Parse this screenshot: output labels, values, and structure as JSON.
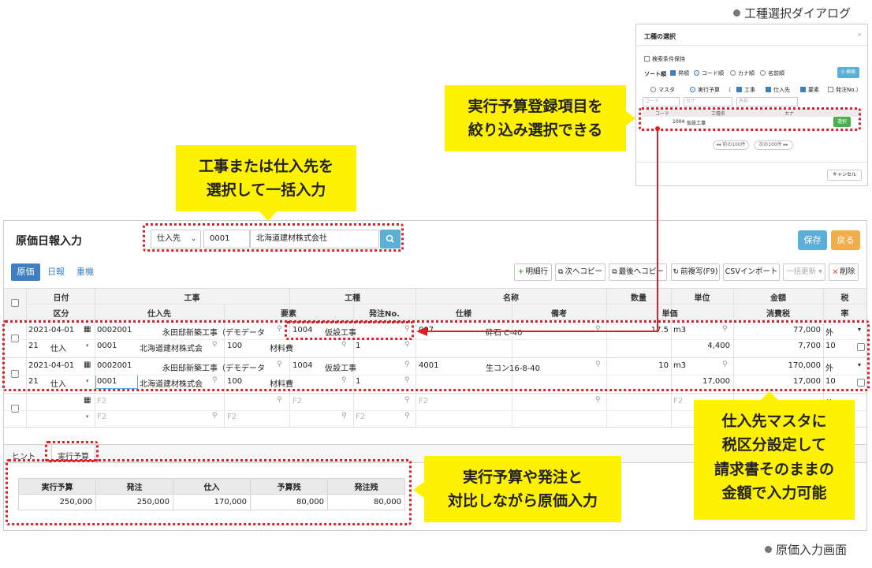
{
  "captions": {
    "dialog": "工種選択ダイアログ",
    "screen": "原価入力画面"
  },
  "colors": {
    "accent": "#3d7fc1",
    "save": "#5ab0d6",
    "back": "#f0ad4e",
    "callout": "#fff200",
    "highlight": "#d92027"
  },
  "callouts": {
    "top": [
      "工事または仕入先を",
      "選択して一括入力"
    ],
    "dialog": [
      "実行予算登録項目を",
      "絞り込み選択できる"
    ],
    "right": [
      "仕入先マスタに",
      "税区分設定して",
      "請求書そのままの",
      "金額で入力可能"
    ],
    "bottom": [
      "実行予算や発注と",
      "対比しながら原価入力"
    ]
  },
  "main": {
    "title": "原価日報入力",
    "filter": {
      "type_label": "仕入先",
      "code": "0001",
      "name": "北海道建材株式会社",
      "search_icon": "search-icon"
    },
    "buttons": {
      "save": "保存",
      "back": "戻る"
    },
    "tabs": [
      "原価",
      "日報",
      "重機"
    ],
    "toolbar": [
      {
        "icon": "+",
        "label": "明細行"
      },
      {
        "icon": "⧉",
        "label": "次へコピー"
      },
      {
        "icon": "⧉",
        "label": "最後へコピー"
      },
      {
        "icon": "↻",
        "label": "前複写(F9)"
      },
      {
        "icon": "",
        "label": "CSVインポート"
      },
      {
        "icon": "",
        "label": "一括更新 ▾"
      },
      {
        "icon": "×",
        "label": "削除"
      }
    ],
    "grid": {
      "headers_top": [
        "日付",
        "工事",
        "工種",
        "名称",
        "数量",
        "単位",
        "金額",
        "税"
      ],
      "headers_bottom": [
        "区分",
        "仕入先",
        "要素",
        "発注No.",
        "仕様",
        "備考",
        "単価",
        "消費税",
        "率"
      ],
      "rows": [
        {
          "date": "2021-04-01",
          "koji_code": "0002001",
          "koji_name": "永田邸新築工事（デモデータ",
          "koshu_code": "1004",
          "koshu_name": "仮設工事",
          "spec_code": "007",
          "spec_name": "砕石 C-40",
          "qty": "17.5",
          "unit": "m3",
          "amount": "77,000",
          "tax": "外",
          "kbn_code": "21",
          "kbn_name": "仕入",
          "vendor_code": "0001",
          "vendor_name": "北海道建材株式会",
          "elem_code": "100",
          "elem_name": "材料費",
          "order_no": "1",
          "price": "4,400",
          "tax_amount": "7,700",
          "rate": "10"
        },
        {
          "date": "2021-04-01",
          "koji_code": "0002001",
          "koji_name": "永田邸新築工事（デモデータ",
          "koshu_code": "1004",
          "koshu_name": "仮設工事",
          "spec_code": "4001",
          "spec_name": "生コン16-8-40",
          "qty": "10",
          "unit": "m3",
          "amount": "170,000",
          "tax": "外",
          "kbn_code": "21",
          "kbn_name": "仕入",
          "vendor_code": "0001",
          "vendor_name": "北海道建材株式会",
          "elem_code": "100",
          "elem_name": "材料費",
          "order_no": "1",
          "price": "17,000",
          "tax_amount": "17,000",
          "rate": "10"
        }
      ],
      "placeholder": "F2",
      "empty_tax": "外"
    },
    "bottom_tabs": [
      "ヒント",
      "実行予算"
    ],
    "budget": {
      "headers": [
        "実行予算",
        "発注",
        "仕入",
        "予算残",
        "発注残"
      ],
      "values": [
        "250,000",
        "250,000",
        "170,000",
        "80,000",
        "80,000"
      ]
    }
  },
  "dialog": {
    "title": "工種の選択",
    "close": "×",
    "keep_search": "検索条件保持",
    "sort_label": "ソート順",
    "sort_asc": "昇順",
    "sort_options": [
      "コード順",
      "カナ順",
      "名前順"
    ],
    "search_button": "検索",
    "source_options": [
      "マスタ",
      "実行予算"
    ],
    "paren": "（",
    "filters": [
      "工事",
      "仕入先",
      "要素",
      "発注No.）"
    ],
    "inputs": [
      "コード",
      "カナ",
      "名前"
    ],
    "columns": [
      "コード",
      "工種名",
      "カナ"
    ],
    "row": {
      "code": "1004",
      "name": "仮設工事",
      "select": "選択"
    },
    "prev": "前の100件",
    "next": "次の100件",
    "cancel": "キャンセル"
  }
}
